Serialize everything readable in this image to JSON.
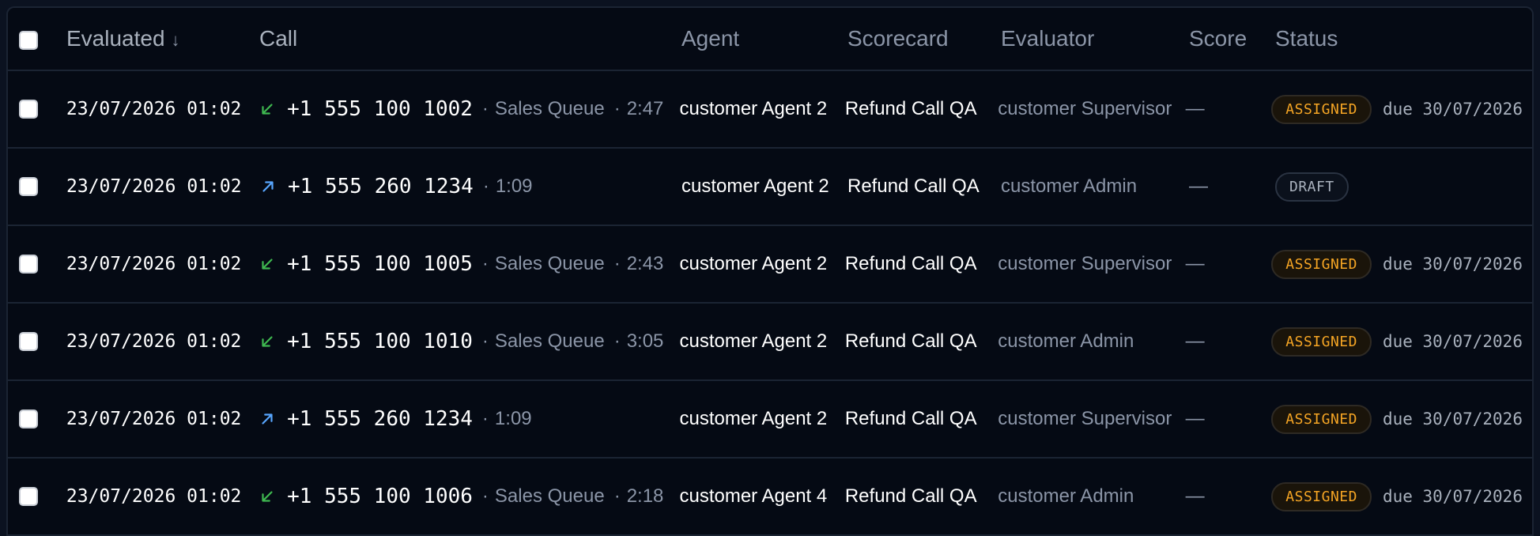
{
  "header": {
    "evaluated": "Evaluated",
    "call": "Call",
    "agent": "Agent",
    "scorecard": "Scorecard",
    "evaluator": "Evaluator",
    "score": "Score",
    "status": "Status",
    "sort_icon": "arrow-down-icon"
  },
  "colors": {
    "inbound": "#3fb950",
    "outbound": "#58a6ff",
    "assigned": "#f5a524"
  },
  "rows": [
    {
      "evaluated": "23/07/2026 01:02",
      "direction": "inbound",
      "phone": "+1 555 100 1002",
      "queue": "Sales Queue",
      "duration": "2:47",
      "agent": "customer Agent 2",
      "scorecard": "Refund Call QA",
      "evaluator": "customer Supervisor",
      "score": "—",
      "status": "ASSIGNED",
      "due": "due 30/07/2026"
    },
    {
      "evaluated": "23/07/2026 01:02",
      "direction": "outbound",
      "phone": "+1 555 260 1234",
      "queue": "",
      "duration": "1:09",
      "agent": "customer Agent 2",
      "scorecard": "Refund Call QA",
      "evaluator": "customer Admin",
      "score": "—",
      "status": "DRAFT",
      "due": ""
    },
    {
      "evaluated": "23/07/2026 01:02",
      "direction": "inbound",
      "phone": "+1 555 100 1005",
      "queue": "Sales Queue",
      "duration": "2:43",
      "agent": "customer Agent 2",
      "scorecard": "Refund Call QA",
      "evaluator": "customer Supervisor",
      "score": "—",
      "status": "ASSIGNED",
      "due": "due 30/07/2026"
    },
    {
      "evaluated": "23/07/2026 01:02",
      "direction": "inbound",
      "phone": "+1 555 100 1010",
      "queue": "Sales Queue",
      "duration": "3:05",
      "agent": "customer Agent 2",
      "scorecard": "Refund Call QA",
      "evaluator": "customer Admin",
      "score": "—",
      "status": "ASSIGNED",
      "due": "due 30/07/2026"
    },
    {
      "evaluated": "23/07/2026 01:02",
      "direction": "outbound",
      "phone": "+1 555 260 1234",
      "queue": "",
      "duration": "1:09",
      "agent": "customer Agent 2",
      "scorecard": "Refund Call QA",
      "evaluator": "customer Supervisor",
      "score": "—",
      "status": "ASSIGNED",
      "due": "due 30/07/2026"
    },
    {
      "evaluated": "23/07/2026 01:02",
      "direction": "inbound",
      "phone": "+1 555 100 1006",
      "queue": "Sales Queue",
      "duration": "2:18",
      "agent": "customer Agent 4",
      "scorecard": "Refund Call QA",
      "evaluator": "customer Admin",
      "score": "—",
      "status": "ASSIGNED",
      "due": "due 30/07/2026"
    }
  ]
}
